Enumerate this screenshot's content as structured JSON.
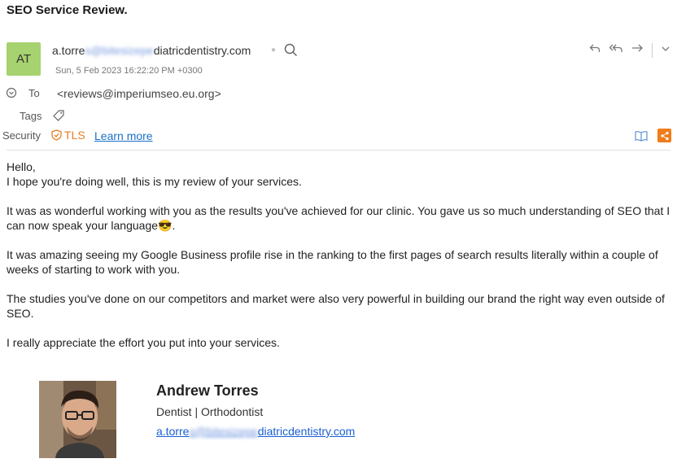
{
  "subject": "SEO Service Review.",
  "header": {
    "avatar_initials": "AT",
    "from_prefix": "a.torre",
    "from_blurred": "s@bitesizepe",
    "from_suffix": "diatricdentistry.com",
    "date": "Sun, 5 Feb 2023 16:22:20 PM +0300",
    "to_label": "To",
    "to_value": "<reviews@imperiumseo.eu.org>",
    "tags_label": "Tags",
    "security_label": "Security",
    "tls": "TLS",
    "learn_more": "Learn more"
  },
  "body": {
    "greeting": "Hello,",
    "line1": "I hope you're doing well, this is my review of your services.",
    "p2a": "It was as wonderful working with you as the results you've achieved for our clinic. You gave us so much understanding of SEO that I can now speak your language",
    "p2_emoji": "😎",
    "p2b": ".",
    "p3": "It was amazing seeing my Google Business profile rise in the ranking to the first pages of search results literally within a couple of weeks of starting to work with you.",
    "p4": "The studies you've done on our competitors and market were also very powerful in building our brand the right way even outside of SEO.",
    "p5": "I really appreciate the effort you put into your services."
  },
  "signature": {
    "name": "Andrew Torres",
    "role": "Dentist | Orthodontist",
    "email_prefix": "a.torre",
    "email_blurred": "s@bitesizepe",
    "email_suffix": "diatricdentistry.com"
  },
  "colors": {
    "avatar": "#a6d26f",
    "accent": "#e67e22",
    "link": "#1a6fc9"
  },
  "icons": [
    "search-icon",
    "reply-icon",
    "reply-all-icon",
    "forward-icon",
    "chevron-down-icon",
    "to-circle-icon",
    "tag-icon",
    "shield-icon",
    "book-icon",
    "share-icon"
  ]
}
